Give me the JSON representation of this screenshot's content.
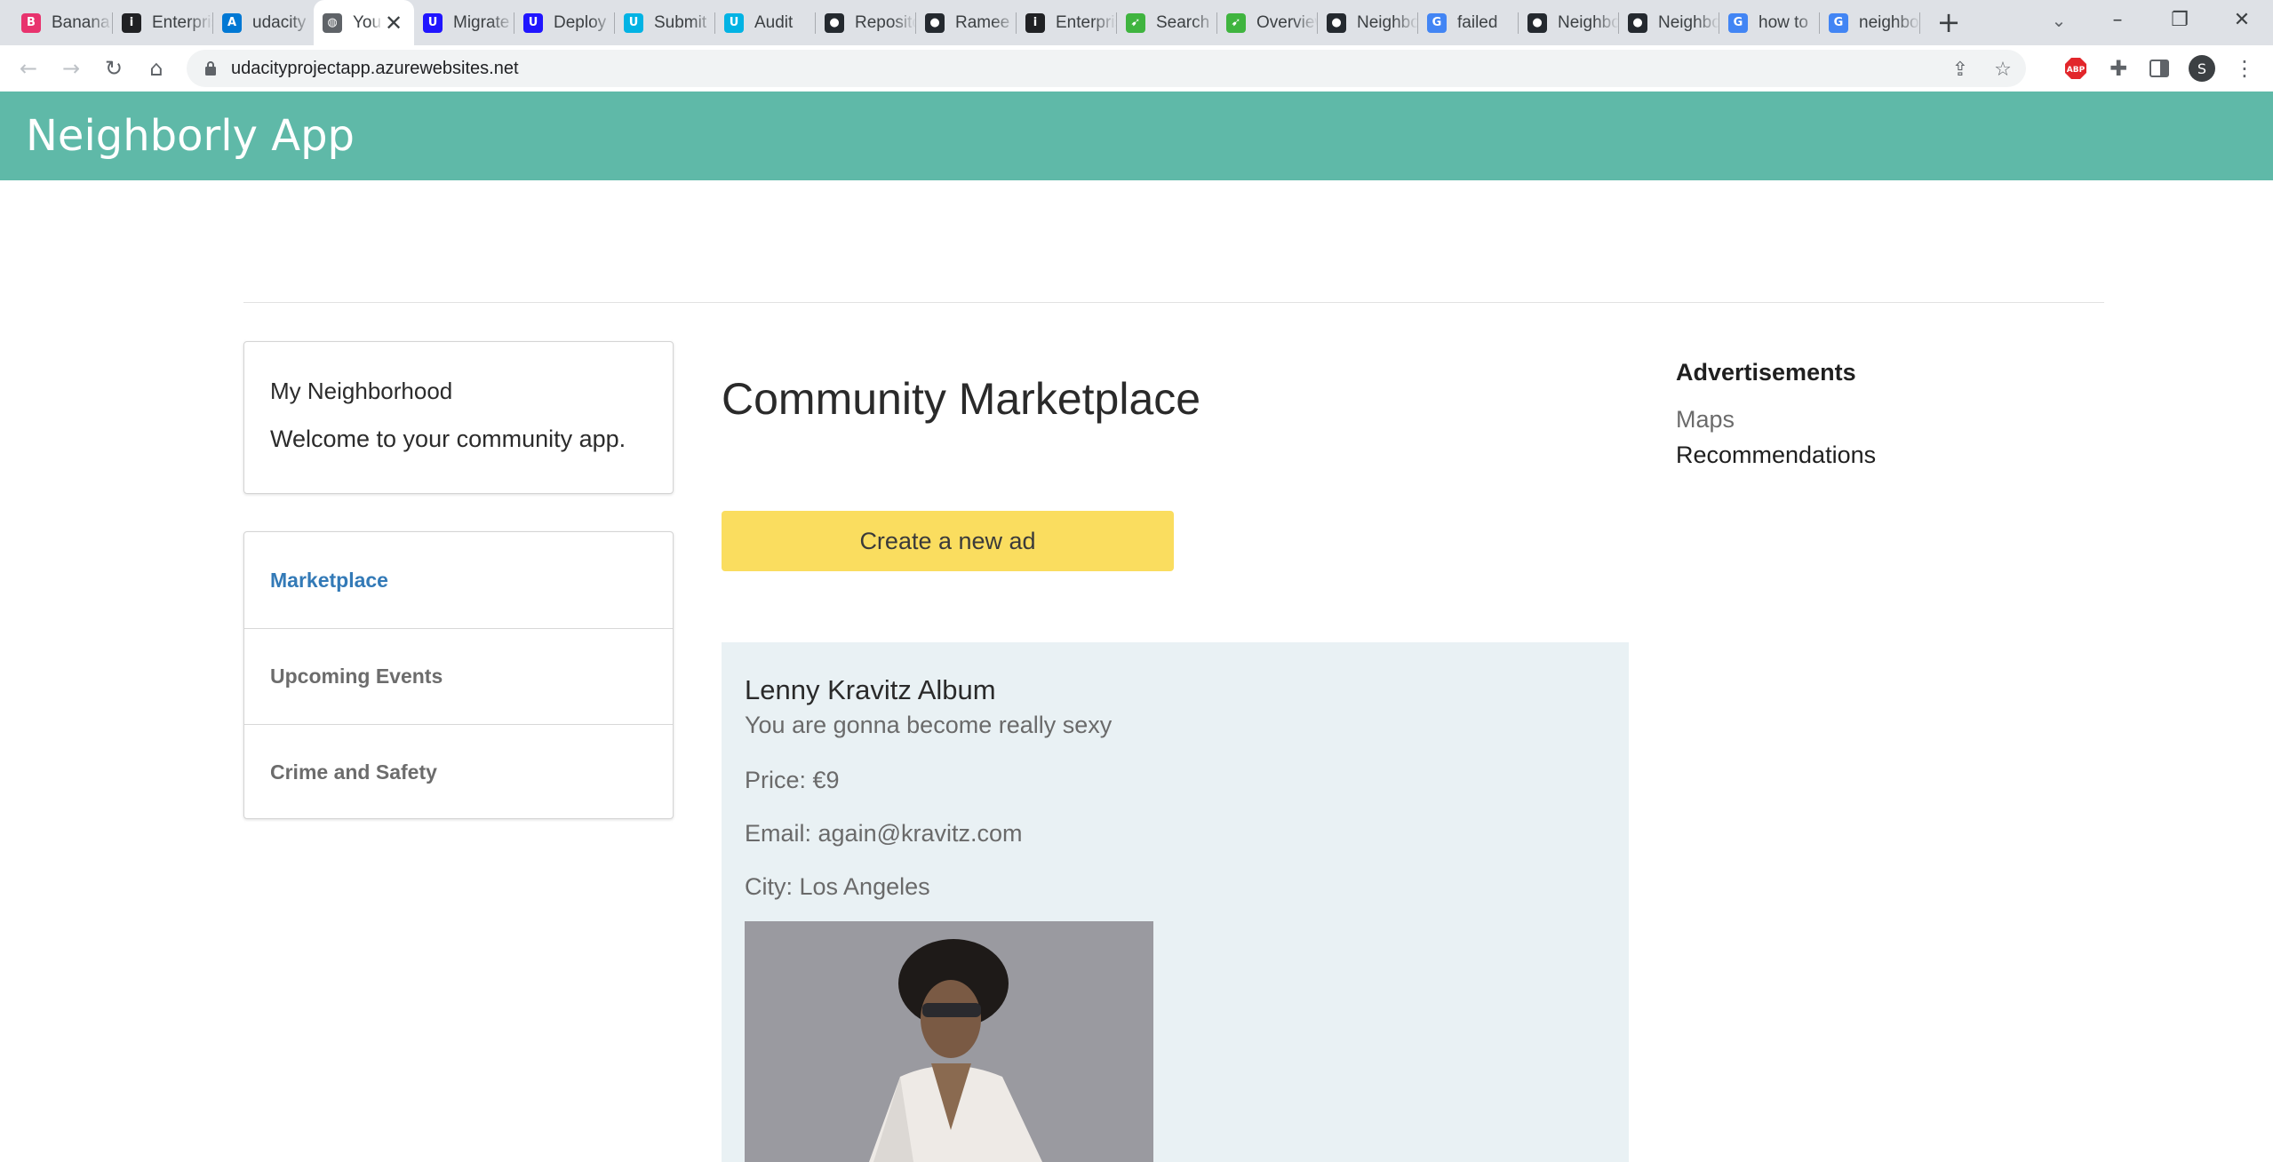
{
  "browser": {
    "tabs": [
      {
        "title": "Banana",
        "icon": "banana-favicon-icon",
        "color": "#e8336e",
        "glyph": "B"
      },
      {
        "title": "Enterprise",
        "icon": "info-favicon-icon",
        "color": "#202124",
        "glyph": "i"
      },
      {
        "title": "udacity",
        "icon": "azure-favicon-icon",
        "color": "#0078d4",
        "glyph": "A"
      },
      {
        "title": "Your",
        "icon": "globe-favicon-icon",
        "color": "#5f6368",
        "glyph": "◍"
      },
      {
        "title": "Migrate",
        "icon": "udacity-favicon-icon",
        "color": "#2015ff",
        "glyph": "U"
      },
      {
        "title": "Deploy",
        "icon": "udacity-favicon-icon",
        "color": "#2015ff",
        "glyph": "U"
      },
      {
        "title": "Submit",
        "icon": "udacity-favicon-icon",
        "color": "#02b3e4",
        "glyph": "U"
      },
      {
        "title": "Audit",
        "icon": "udacity-favicon-icon",
        "color": "#02b3e4",
        "glyph": "U"
      },
      {
        "title": "Repository",
        "icon": "github-favicon-icon",
        "color": "#24292f",
        "glyph": "●"
      },
      {
        "title": "Ramee",
        "icon": "github-favicon-icon",
        "color": "#24292f",
        "glyph": "●"
      },
      {
        "title": "Enterprise",
        "icon": "info-favicon-icon",
        "color": "#202124",
        "glyph": "i"
      },
      {
        "title": "Search",
        "icon": "leaf-favicon-icon",
        "color": "#3fb43f",
        "glyph": "➹"
      },
      {
        "title": "Overview",
        "icon": "leaf-favicon-icon",
        "color": "#3fb43f",
        "glyph": "➹"
      },
      {
        "title": "Neighborly",
        "icon": "github-favicon-icon",
        "color": "#24292f",
        "glyph": "●"
      },
      {
        "title": "failed",
        "icon": "google-favicon-icon",
        "color": "#4285f4",
        "glyph": "G"
      },
      {
        "title": "Neighborly",
        "icon": "github-favicon-icon",
        "color": "#24292f",
        "glyph": "●"
      },
      {
        "title": "Neighborly",
        "icon": "github-favicon-icon",
        "color": "#24292f",
        "glyph": "●"
      },
      {
        "title": "how to",
        "icon": "google-favicon-icon",
        "color": "#4285f4",
        "glyph": "G"
      },
      {
        "title": "neighborly",
        "icon": "google-favicon-icon",
        "color": "#4285f4",
        "glyph": "G"
      }
    ],
    "active_tab_index": 3,
    "url": "udacityprojectapp.azurewebsites.net",
    "profile_initial": "S",
    "abp_label": "ABP"
  },
  "app": {
    "name": "Neighborly App"
  },
  "left_card": {
    "title": "My Neighborhood",
    "text": "Welcome to your community app."
  },
  "menu": [
    {
      "label": "Marketplace",
      "active": true
    },
    {
      "label": "Upcoming Events",
      "active": false
    },
    {
      "label": "Crime and Safety",
      "active": false
    }
  ],
  "main": {
    "title": "Community Marketplace",
    "create_button": "Create a new ad",
    "ad": {
      "title": "Lenny Kravitz Album",
      "description": "You are gonna become really sexy",
      "price": "Price: €9",
      "email": "Email: again@kravitz.com",
      "city": "City: Los Angeles"
    }
  },
  "right": {
    "title": "Advertisements",
    "links": [
      "Maps",
      "Recommendations"
    ]
  },
  "colors": {
    "header": "#5fb9a8",
    "create_button": "#fadd5f",
    "ad_panel": "#e9f1f4",
    "active_link": "#337ab7"
  }
}
